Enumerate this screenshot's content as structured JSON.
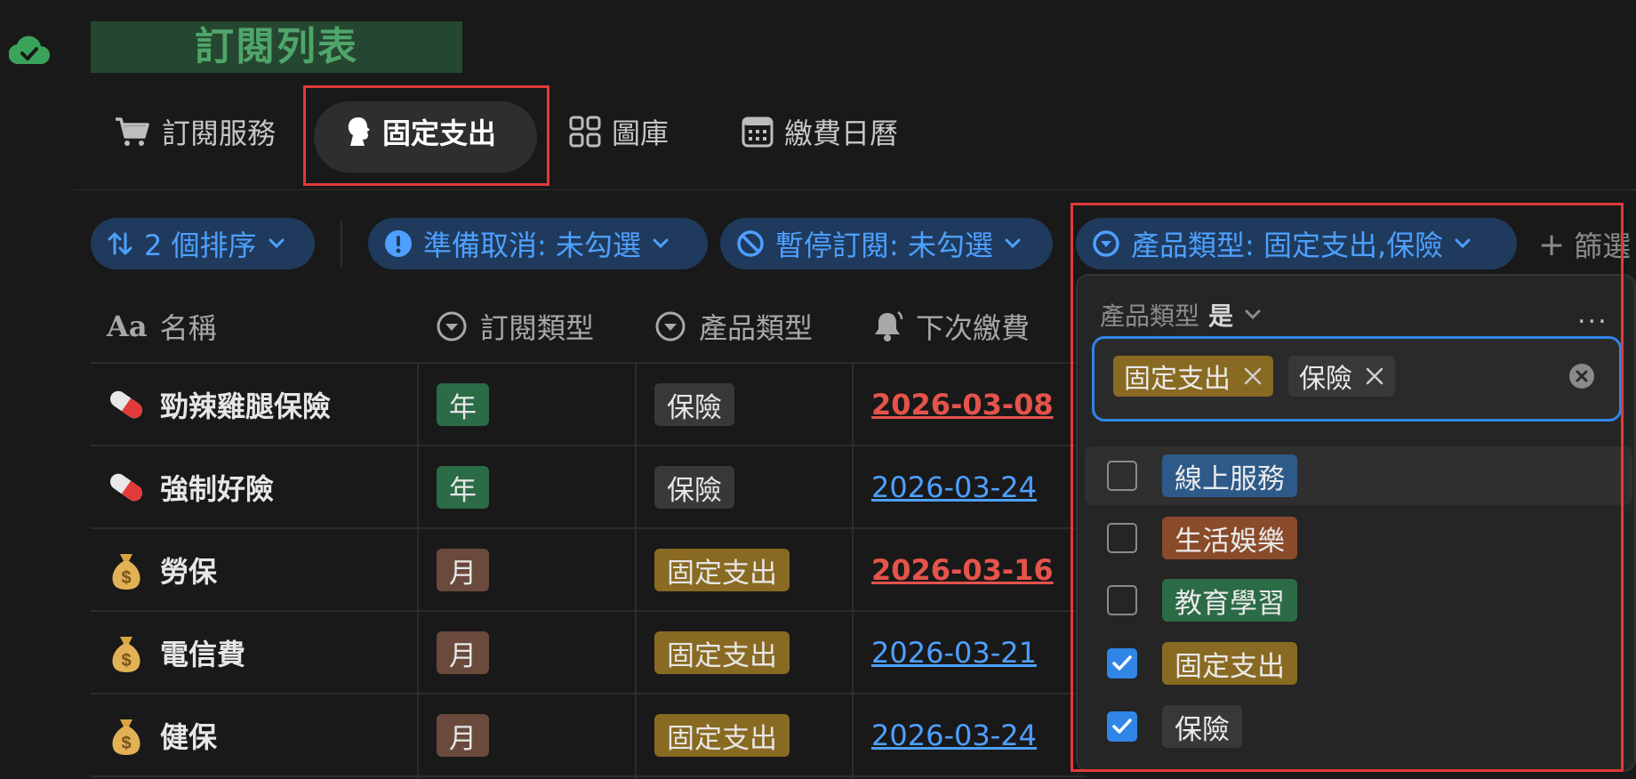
{
  "page": {
    "title": "訂閱列表"
  },
  "tabs": [
    {
      "label": "訂閱服務",
      "icon": "cart-icon"
    },
    {
      "label": "固定支出",
      "icon": "person-silhouette-icon",
      "active": true
    },
    {
      "label": "圖庫",
      "icon": "gallery-grid-icon"
    },
    {
      "label": "繳費日曆",
      "icon": "calendar-icon"
    }
  ],
  "filters": {
    "sort": "2 個排序",
    "cancel_ready": "準備取消: 未勾選",
    "paused": "暫停訂閱: 未勾選",
    "product_type": "產品類型: 固定支出,保險",
    "add_filter": "篩選"
  },
  "table": {
    "headers": {
      "name": "名稱",
      "sub_type": "訂閱類型",
      "product_type": "產品類型",
      "next_payment": "下次繳費"
    },
    "rows": [
      {
        "emoji": "pill",
        "name": "勁辣雞腿保險",
        "sub_type": "年",
        "product_type": "保險",
        "next_payment": "2026-03-08",
        "date_color": "red"
      },
      {
        "emoji": "pill",
        "name": "強制好險",
        "sub_type": "年",
        "product_type": "保險",
        "next_payment": "2026-03-24",
        "date_color": "blue"
      },
      {
        "emoji": "money-bag",
        "name": "勞保",
        "sub_type": "月",
        "product_type": "固定支出",
        "next_payment": "2026-03-16",
        "date_color": "red"
      },
      {
        "emoji": "money-bag",
        "name": "電信費",
        "sub_type": "月",
        "product_type": "固定支出",
        "next_payment": "2026-03-21",
        "date_color": "blue"
      },
      {
        "emoji": "money-bag",
        "name": "健保",
        "sub_type": "月",
        "product_type": "固定支出",
        "next_payment": "2026-03-24",
        "date_color": "blue"
      }
    ]
  },
  "popover": {
    "property": "產品類型",
    "operator": "是",
    "more": "...",
    "selected": [
      "固定支出",
      "保險"
    ],
    "options": [
      {
        "label": "線上服務",
        "checked": false,
        "color": "#2d5a88"
      },
      {
        "label": "生活娛樂",
        "checked": false,
        "color": "#8a4b2b"
      },
      {
        "label": "教育學習",
        "checked": false,
        "color": "#2b6b45"
      },
      {
        "label": "固定支出",
        "checked": true,
        "color": "#896a22"
      },
      {
        "label": "保險",
        "checked": true,
        "color": "#383838"
      }
    ]
  },
  "colors": {
    "accent": "#2f86e6",
    "chip_bg": "#1f3a5c",
    "chip_text": "#4ea0ff",
    "date_overdue": "#e5534b",
    "highlight_box": "#e03a3a"
  }
}
